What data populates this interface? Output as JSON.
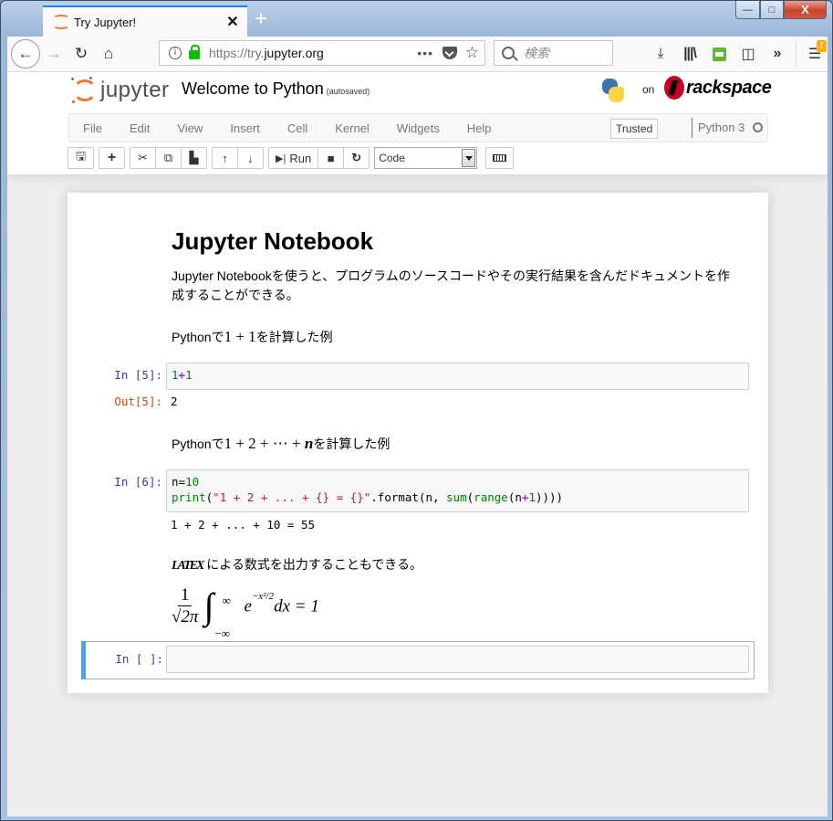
{
  "browser": {
    "tab_title": "Try Jupyter!",
    "url_prefix": "https://try.",
    "url_domain": "jupyter.org",
    "search_placeholder": "検索",
    "window_controls": {
      "minimize": "—",
      "maximize": "□",
      "close": "X"
    },
    "icons": [
      "back-icon",
      "forward-icon",
      "reload-icon",
      "home-icon",
      "info-icon",
      "lock-icon",
      "page-actions-icon",
      "pocket-icon",
      "bookmark-star-icon",
      "search-icon",
      "download-icon",
      "library-icon",
      "print-icon",
      "sidebar-icon",
      "overflow-icon",
      "hamburger-menu-icon"
    ],
    "menu_badge": "!"
  },
  "jupyter": {
    "logo_text": "jupyter",
    "notebook_name": "Welcome to Python",
    "autosave_status": "(autosaved)",
    "on_label": "on",
    "host_brand": "rackspace",
    "menu": [
      "File",
      "Edit",
      "View",
      "Insert",
      "Cell",
      "Kernel",
      "Widgets",
      "Help"
    ],
    "trusted_label": "Trusted",
    "kernel_name": "Python 3",
    "toolbar": {
      "run_label": "Run",
      "cell_type": "Code"
    }
  },
  "notebook": {
    "heading": "Jupyter Notebook",
    "intro_line1": "Jupyter Notebookを使うと、プログラムのソースコードやその実行結果を含んだドキュメントを作",
    "intro_line2": "成することができる。",
    "example1_prefix": "Pythonで",
    "example1_math": "1 + 1",
    "example1_suffix": "を計算した例",
    "cell1": {
      "prompt_in": "In [5]:",
      "code_num1": "1",
      "code_op": "+",
      "code_num2": "1",
      "prompt_out": "Out[5]:",
      "output": "2"
    },
    "example2_prefix": "Pythonで",
    "example2_math": "1 + 2 + ⋯ + ",
    "example2_var": "n",
    "example2_suffix": "を計算した例",
    "cell2": {
      "prompt_in": "In [6]:",
      "line1_var": "n=",
      "line1_num": "10",
      "line2_print": "print",
      "line2_open": "(",
      "line2_str": "\"1 + 2 + ... + {} = {}\"",
      "line2_format": ".format(n, ",
      "line2_sum": "sum",
      "line2_paren": "(",
      "line2_range": "range",
      "line2_rparen": "(n",
      "line2_op": "+",
      "line2_one": "1",
      "line2_close": "))))",
      "output": "1 + 2 + ... + 10 = 55"
    },
    "latex_logo": "LATEX",
    "latex_text": "による数式を出力することもできる。",
    "equation": {
      "numerator": "1",
      "denominator": "√2π",
      "upper": "∞",
      "lower": "−∞",
      "base": "e",
      "exponent": "−x²/2",
      "rest": "dx = 1"
    },
    "cell3": {
      "prompt_in": "In [ ]:",
      "code": ""
    }
  }
}
